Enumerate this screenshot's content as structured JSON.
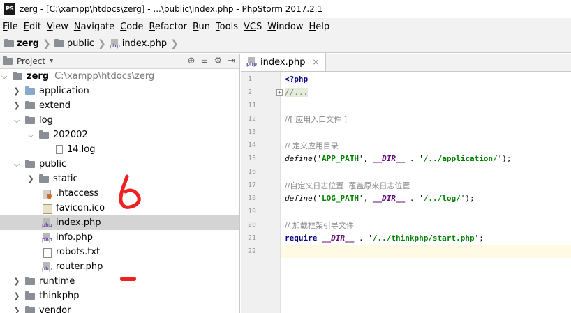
{
  "window": {
    "app_icon_label": "PS",
    "title": "zerg - [C:\\xampp\\htdocs\\zerg] - ...\\public\\index.php - PhpStorm 2017.2.1"
  },
  "menu": [
    {
      "mn": "F",
      "rest": "ile"
    },
    {
      "mn": "E",
      "rest": "dit"
    },
    {
      "mn": "V",
      "rest": "iew"
    },
    {
      "mn": "N",
      "rest": "avigate"
    },
    {
      "mn": "C",
      "rest": "ode"
    },
    {
      "mn": "R",
      "rest": "efactor"
    },
    {
      "mn": "R",
      "rest": "un"
    },
    {
      "mn": "T",
      "rest": "ools"
    },
    {
      "mn": "VC",
      "rest": "S"
    },
    {
      "mn": "W",
      "rest": "indow"
    },
    {
      "mn": "H",
      "rest": "elp"
    }
  ],
  "breadcrumbs": [
    "zerg",
    "public",
    "index.php"
  ],
  "project_panel": {
    "title": "Project",
    "dropdown_icon": "chevron-down-icon",
    "tools": [
      "⊕",
      "≡",
      "⚙",
      "⇥"
    ]
  },
  "tree": {
    "root_name": "zerg",
    "root_path": "C:\\xampp\\htdocs\\zerg",
    "application": "application",
    "extend": "extend",
    "log": "log",
    "log_sub": "202002",
    "log_file": "14.log",
    "public": "public",
    "static": "static",
    "htaccess": ".htaccess",
    "favicon": "favicon.ico",
    "index": "index.php",
    "info": "info.php",
    "robots": "robots.txt",
    "router": "router.php",
    "runtime": "runtime",
    "thinkphp": "thinkphp",
    "vendor": "vendor"
  },
  "editor": {
    "tab_label": "index.php",
    "tab_close": "×",
    "line_numbers": [
      "1",
      "2",
      "11",
      "12",
      "13",
      "14",
      "15",
      "16",
      "17",
      "18",
      "19",
      "20",
      "21",
      "22"
    ],
    "fold_marker": "+",
    "code": {
      "l1": "<?php",
      "l2": "//...",
      "l12": "//[ 应用入口文件 ]",
      "l14": "// 定义应用目录",
      "l15_fn": "define",
      "l15_open": "('",
      "l15_name": "APP_PATH",
      "l15_mid": "', ",
      "l15_const": "__DIR__",
      "l15_dot": " . '",
      "l15_path": "/../application/",
      "l15_end": "');",
      "l17": "//自定义日志位置  覆盖原来日志位置",
      "l18_fn": "define",
      "l18_open": "('",
      "l18_name": "LOG_PATH",
      "l18_mid": "', ",
      "l18_const": "__DIR__",
      "l18_dot": " . '",
      "l18_path": "/../log/",
      "l18_end": "');",
      "l20": "// 加载框架引导文件",
      "l21_kw": "require",
      "l21_const": "__DIR__",
      "l21_dot": " . '",
      "l21_path": "/../thinkphp/start.php",
      "l21_end": "';"
    }
  },
  "colors": {
    "annotation": "#ee2020",
    "selection": "#d4d4d4",
    "current_line": "#fffae3"
  }
}
